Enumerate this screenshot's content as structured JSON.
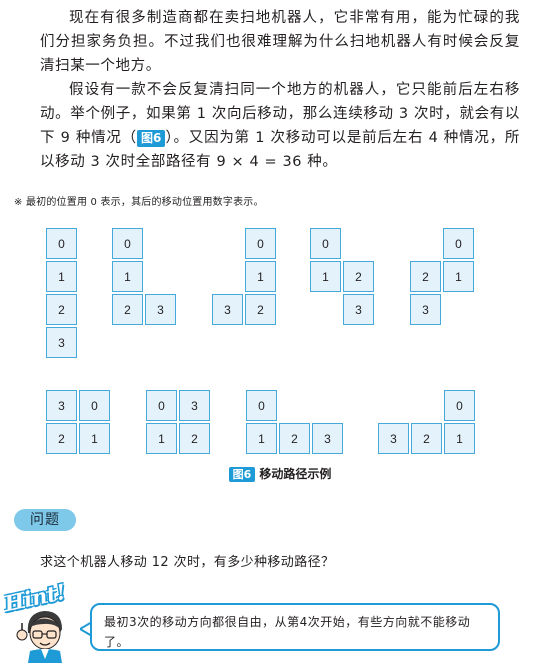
{
  "paragraphs": {
    "p1": "现在有很多制造商都在卖扫地机器人，它非常有用，能为忙碌的我们分担家务负担。不过我们也很难理解为什么扫地机器人有时候会反复清扫某一个地方。",
    "p2_before": "假设有一款不会反复清扫同一个地方的机器人，它只能前后左右移动。举个例子，如果第 1 次向后移动，那么连续移动 3 次时，就会有以下 9 种情况（",
    "p2_figref": "图6",
    "p2_after": "）。又因为第 1 次移动可以是前后左右 4 种情况，所以移动 3 次时全部路径有 9 × 4 = 36 种。"
  },
  "note": "※ 最初的位置用 0 表示，其后的移动位置用数字表示。",
  "figures": [
    {
      "cells": [
        {
          "c": 0,
          "r": 0,
          "v": "0"
        },
        {
          "c": 0,
          "r": 1,
          "v": "1"
        },
        {
          "c": 0,
          "r": 2,
          "v": "2"
        },
        {
          "c": 0,
          "r": 3,
          "v": "3"
        }
      ]
    },
    {
      "cells": [
        {
          "c": 0,
          "r": 0,
          "v": "0"
        },
        {
          "c": 0,
          "r": 1,
          "v": "1"
        },
        {
          "c": 0,
          "r": 2,
          "v": "2"
        },
        {
          "c": 1,
          "r": 2,
          "v": "3"
        }
      ]
    },
    {
      "cells": [
        {
          "c": 1,
          "r": 0,
          "v": "0"
        },
        {
          "c": 1,
          "r": 1,
          "v": "1"
        },
        {
          "c": 1,
          "r": 2,
          "v": "2"
        },
        {
          "c": 0,
          "r": 2,
          "v": "3"
        }
      ]
    },
    {
      "cells": [
        {
          "c": 0,
          "r": 0,
          "v": "0"
        },
        {
          "c": 0,
          "r": 1,
          "v": "1"
        },
        {
          "c": 1,
          "r": 1,
          "v": "2"
        },
        {
          "c": 1,
          "r": 2,
          "v": "3"
        }
      ]
    },
    {
      "cells": [
        {
          "c": 1,
          "r": 0,
          "v": "0"
        },
        {
          "c": 1,
          "r": 1,
          "v": "1"
        },
        {
          "c": 0,
          "r": 1,
          "v": "2"
        },
        {
          "c": 0,
          "r": 2,
          "v": "3"
        }
      ]
    },
    {
      "cells": [
        {
          "c": 1,
          "r": 0,
          "v": "0"
        },
        {
          "c": 1,
          "r": 1,
          "v": "1"
        },
        {
          "c": 0,
          "r": 1,
          "v": "2"
        },
        {
          "c": 0,
          "r": 0,
          "v": "3"
        }
      ]
    },
    {
      "cells": [
        {
          "c": 0,
          "r": 0,
          "v": "0"
        },
        {
          "c": 0,
          "r": 1,
          "v": "1"
        },
        {
          "c": 1,
          "r": 1,
          "v": "2"
        },
        {
          "c": 1,
          "r": 0,
          "v": "3"
        }
      ]
    },
    {
      "cells": [
        {
          "c": 0,
          "r": 0,
          "v": "0"
        },
        {
          "c": 0,
          "r": 1,
          "v": "1"
        },
        {
          "c": 1,
          "r": 1,
          "v": "2"
        },
        {
          "c": 2,
          "r": 1,
          "v": "3"
        }
      ]
    },
    {
      "cells": [
        {
          "c": 2,
          "r": 0,
          "v": "0"
        },
        {
          "c": 2,
          "r": 1,
          "v": "1"
        },
        {
          "c": 1,
          "r": 1,
          "v": "2"
        },
        {
          "c": 0,
          "r": 1,
          "v": "3"
        }
      ]
    }
  ],
  "caption": {
    "tag": "图6",
    "text": "移动路径示例"
  },
  "problem": {
    "badge": "问题",
    "text": "求这个机器人移动 12 次时，有多少种移动路径？"
  },
  "hint": {
    "word": "Hint!",
    "text": "最初3次的移动方向都很自由，从第4次开始，有些方向就不能移动了。"
  },
  "colors": {
    "accent": "#1e9ad6",
    "cell_fill": "#e3f2fb",
    "cell_border": "#45a9dc",
    "badge": "#7ec8ea"
  }
}
